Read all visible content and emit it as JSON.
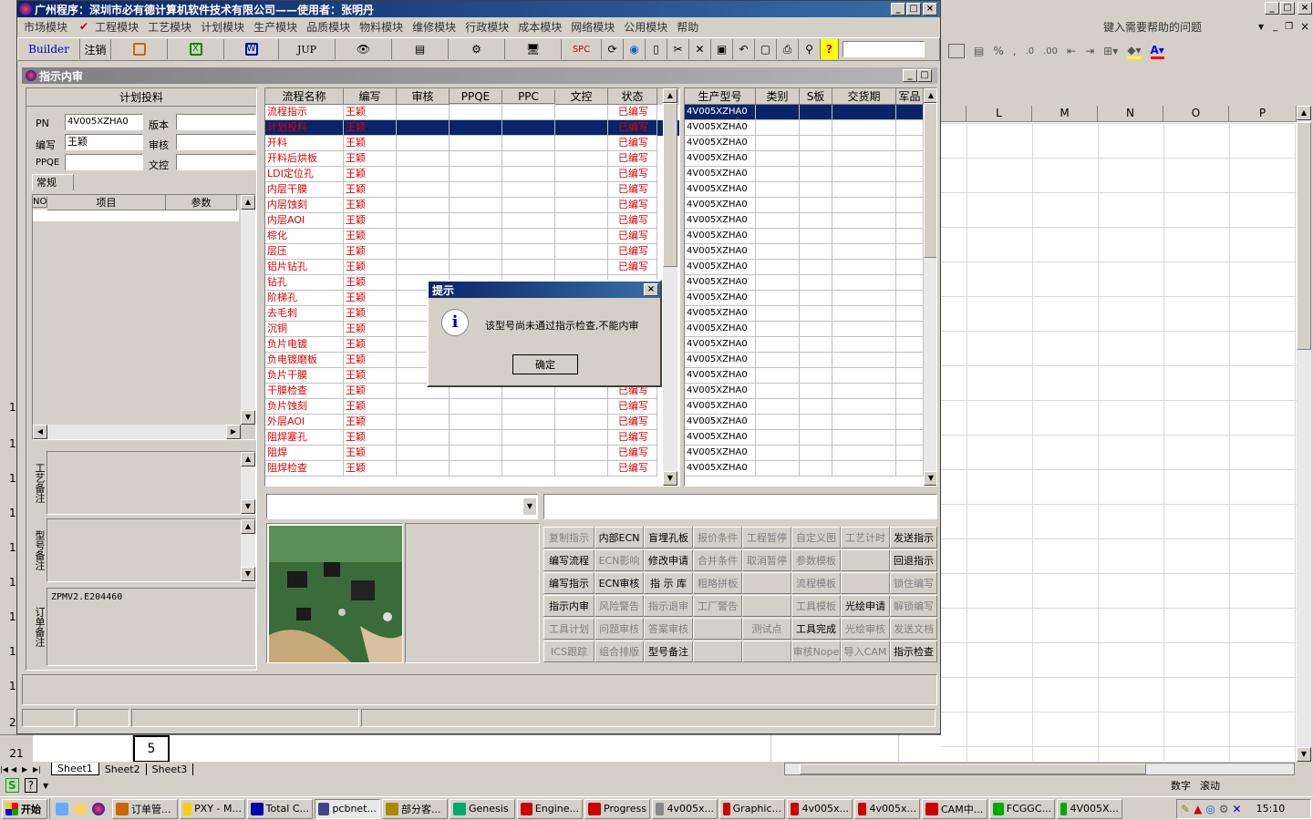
{
  "app": {
    "title": "广州程序：深圳市必有德计算机软件技术有限公司——使用者：张明丹"
  },
  "menu": [
    "市场模块",
    "工程模块",
    "工艺模块",
    "计划模块",
    "生产模块",
    "品质模块",
    "物料模块",
    "维修模块",
    "行政模块",
    "成本模块",
    "网络模块",
    "公用模块",
    "帮助"
  ],
  "toolbar": {
    "builder": "Builder",
    "logout": "注销",
    "jup": "JUP",
    "spc": "SPC"
  },
  "excel": {
    "help_placeholder": "键入需要帮助的问题",
    "columns": [
      "L",
      "M",
      "N",
      "O",
      "P"
    ],
    "row_numbers": [
      "1",
      "1",
      "1",
      "1",
      "1",
      "1",
      "1",
      "1",
      "1",
      "2",
      "21"
    ],
    "cell_value": "5",
    "sheets": [
      "Sheet1",
      "Sheet2",
      "Sheet3"
    ],
    "status_num": "数字",
    "status_scroll": "滚动",
    "percent": "%",
    "comma": ","
  },
  "child": {
    "title": "指示内审"
  },
  "left": {
    "title": "计划投料",
    "pn_label": "PN",
    "pn_value": "4V005XZHA0",
    "version_label": "版本",
    "writer_label": "编写",
    "writer_value": "王颖",
    "review_label": "审核",
    "ppqe_label": "PPQE",
    "wenkong_label": "文控",
    "tab": "常规",
    "param_cols": [
      "NO",
      "项目",
      "参数"
    ],
    "note1": "工艺备注",
    "note2": "型号备注",
    "note3": "订单备注",
    "order_note": "ZPMV2.E204460"
  },
  "flow": {
    "columns": [
      "流程名称",
      "编写",
      "审核",
      "PPQE",
      "PPC",
      "文控",
      "状态"
    ],
    "rows": [
      {
        "name": "流程指示",
        "writer": "王颖",
        "status": "已编写"
      },
      {
        "name": "计划投料",
        "writer": "王颖",
        "status": "已编写"
      },
      {
        "name": "开料",
        "writer": "王颖",
        "status": "已编写"
      },
      {
        "name": "开料后烘板",
        "writer": "王颖",
        "status": "已编写"
      },
      {
        "name": "LDI定位孔",
        "writer": "王颖",
        "status": "已编写"
      },
      {
        "name": "内层干膜",
        "writer": "王颖",
        "status": "已编写"
      },
      {
        "name": "内层蚀刻",
        "writer": "王颖",
        "status": "已编写"
      },
      {
        "name": "内层AOI",
        "writer": "王颖",
        "status": "已编写"
      },
      {
        "name": "棕化",
        "writer": "王颖",
        "status": "已编写"
      },
      {
        "name": "层压",
        "writer": "王颖",
        "status": "已编写"
      },
      {
        "name": "铝片钻孔",
        "writer": "王颖",
        "status": "已编写"
      },
      {
        "name": "钻孔",
        "writer": "王颖",
        "status": ""
      },
      {
        "name": "阶梯孔",
        "writer": "王颖",
        "status": ""
      },
      {
        "name": "去毛刺",
        "writer": "王颖",
        "status": ""
      },
      {
        "name": "沉铜",
        "writer": "王颖",
        "status": ""
      },
      {
        "name": "负片电镀",
        "writer": "王颖",
        "status": ""
      },
      {
        "name": "负电镀磨板",
        "writer": "王颖",
        "status": ""
      },
      {
        "name": "负片干膜",
        "writer": "王颖",
        "status": ""
      },
      {
        "name": "干膜检查",
        "writer": "王颖",
        "status": "已编写"
      },
      {
        "name": "负片蚀刻",
        "writer": "王颖",
        "status": "已编写"
      },
      {
        "name": "外层AOI",
        "writer": "王颖",
        "status": "已编写"
      },
      {
        "name": "阻焊塞孔",
        "writer": "王颖",
        "status": "已编写"
      },
      {
        "name": "阻焊",
        "writer": "王颖",
        "status": "已编写"
      },
      {
        "name": "阻焊检查",
        "writer": "王颖",
        "status": "已编写"
      }
    ]
  },
  "models": {
    "columns": [
      "生产型号",
      "类别",
      "S板",
      "交货期",
      "军品"
    ],
    "value": "4V005XZHA0",
    "count": 24
  },
  "buttons": [
    [
      "复制指示",
      "内部ECN",
      "盲埋孔板",
      "报价条件",
      "工程暂停",
      "自定义图",
      "工艺计时",
      "发送指示"
    ],
    [
      "编写流程",
      "ECN影响",
      "修改申请",
      "合并条件",
      "取消暂停",
      "参数模板",
      "",
      "回退指示"
    ],
    [
      "编写指示",
      "ECN审核",
      "指 示 库",
      "粗略拼板",
      "",
      "流程模板",
      "",
      "锁住编写"
    ],
    [
      "指示内审",
      "风险警告",
      "指示退审",
      "工厂警告",
      "",
      "工具模板",
      "光绘申请",
      "解锁编写"
    ],
    [
      "工具计划",
      "问题审核",
      "答案审核",
      "",
      "测试点",
      "工具完成",
      "光绘审核",
      "发送文档"
    ],
    [
      "ICS跟踪",
      "组合排版",
      "型号备注",
      "",
      "",
      "审核Nope",
      "导入CAM",
      "指示检查"
    ]
  ],
  "buttons_enabled": [
    [
      false,
      true,
      true,
      false,
      false,
      false,
      false,
      true
    ],
    [
      true,
      false,
      true,
      false,
      false,
      false,
      false,
      true
    ],
    [
      true,
      true,
      true,
      false,
      false,
      false,
      false,
      false
    ],
    [
      true,
      false,
      false,
      false,
      false,
      false,
      true,
      false
    ],
    [
      false,
      false,
      false,
      false,
      false,
      true,
      false,
      false
    ],
    [
      false,
      false,
      true,
      false,
      false,
      false,
      false,
      true
    ]
  ],
  "dialog": {
    "title": "提示",
    "message": "该型号尚未通过指示检查,不能内审",
    "ok": "确定"
  },
  "taskbar": {
    "start": "开始",
    "items": [
      "订单管...",
      "PXY - M...",
      "Total C...",
      "pcbnet...",
      "部分客...",
      "Genesis",
      "Engine...",
      "Progress",
      "4v005x...",
      "Graphic...",
      "4v005x...",
      "4v005x...",
      "CAM中...",
      "FCGGC...",
      "4V005X..."
    ],
    "clock": "15:10"
  }
}
